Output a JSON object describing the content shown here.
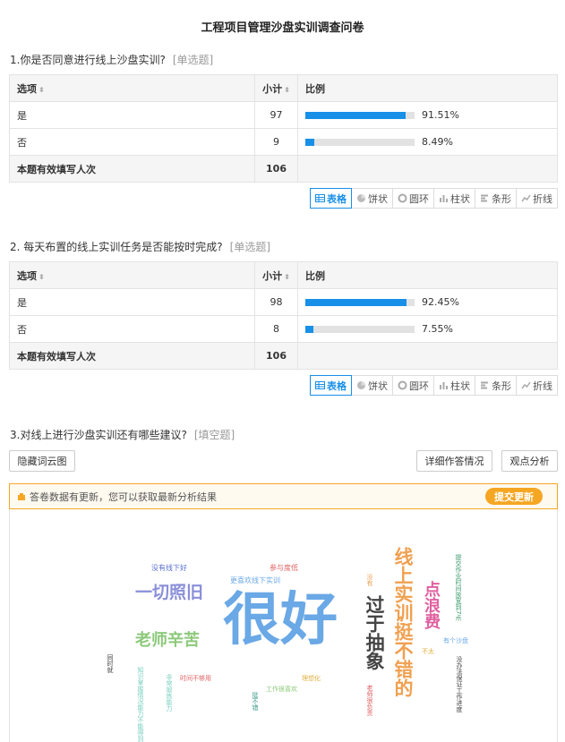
{
  "page_title": "工程项目管理沙盘实训调查问卷",
  "q1": {
    "title": "1.你是否同意进行线上沙盘实训?",
    "type": "[单选题]",
    "headers": {
      "option": "选项",
      "count": "小计",
      "ratio": "比例"
    },
    "rows": [
      {
        "option": "是",
        "count": "97",
        "pct": "91.51%",
        "fraction": 0.9151
      },
      {
        "option": "否",
        "count": "9",
        "pct": "8.49%",
        "fraction": 0.0849
      }
    ],
    "total_label": "本题有效填写人次",
    "total": "106"
  },
  "q2": {
    "title": "2. 每天布置的线上实训任务是否能按时完成?",
    "type": "[单选题]",
    "headers": {
      "option": "选项",
      "count": "小计",
      "ratio": "比例"
    },
    "rows": [
      {
        "option": "是",
        "count": "98",
        "pct": "92.45%",
        "fraction": 0.9245
      },
      {
        "option": "否",
        "count": "8",
        "pct": "7.55%",
        "fraction": 0.0755
      }
    ],
    "total_label": "本题有效填写人次",
    "total": "106"
  },
  "view_buttons": [
    "表格",
    "饼状",
    "圆环",
    "柱状",
    "条形",
    "折线"
  ],
  "q3": {
    "title": "3.对线上进行沙盘实训还有哪些建议?",
    "type": "[填空题]",
    "hide_cloud": "隐藏词云图",
    "detail": "详细作答情况",
    "analysis": "观点分析",
    "notice": "答卷数据有更新，您可以获取最新分析结果",
    "submit": "提交更新"
  },
  "wordcloud": [
    {
      "text": "很好",
      "color": "#6aa8e6"
    },
    {
      "text": "一切照旧",
      "color": "#8a8fd8"
    },
    {
      "text": "老师辛苦",
      "color": "#8cc97a"
    },
    {
      "text": "没有线下好",
      "color": "#5a6fd0"
    },
    {
      "text": "更喜欢线下实训",
      "color": "#6aa8e6"
    },
    {
      "text": "参与度低",
      "color": "#e06060"
    },
    {
      "text": "线上实训挺不错的",
      "color": "#f0a050"
    },
    {
      "text": "过于抽象",
      "color": "#444444"
    },
    {
      "text": "点浪费",
      "color": "#e060a0"
    },
    {
      "text": "没有",
      "color": "#f0a050"
    },
    {
      "text": "提交作业时间放宽到7点",
      "color": "#3a9a6a"
    },
    {
      "text": "有个沙盘",
      "color": "#6aa8e6"
    },
    {
      "text": "没办法保证工作进度",
      "color": "#444444"
    },
    {
      "text": "不太",
      "color": "#e0b040"
    },
    {
      "text": "同时就",
      "color": "#444444"
    },
    {
      "text": "知识掌握情况能力不能得到",
      "color": "#7ad0c0"
    },
    {
      "text": "非常锻炼能力",
      "color": "#7ad0c0"
    },
    {
      "text": "时间不够用",
      "color": "#e06060"
    },
    {
      "text": "工作很喜欢",
      "color": "#8cc97a"
    },
    {
      "text": "理想化",
      "color": "#e0b040"
    },
    {
      "text": "老师很负责",
      "color": "#e06060"
    },
    {
      "text": "挺不错",
      "color": "#3a9a8a"
    }
  ]
}
